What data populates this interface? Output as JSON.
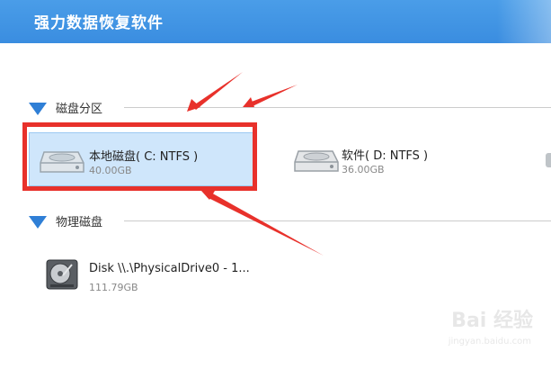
{
  "app": {
    "title": "强力数据恢复软件"
  },
  "sections": {
    "partitions": {
      "label": "磁盘分区"
    },
    "physical": {
      "label": "物理磁盘"
    }
  },
  "drives": [
    {
      "name": "本地磁盘( C: NTFS )",
      "size": "40.00GB",
      "icon": "drive-icon",
      "selected": true
    },
    {
      "name": "软件( D: NTFS )",
      "size": "36.00GB",
      "icon": "drive-icon",
      "selected": false
    }
  ],
  "physical_disks": [
    {
      "name": "Disk \\\\.\\PhysicalDrive0 - 1...",
      "size": "111.79GB",
      "icon": "hard-disk-icon"
    }
  ],
  "annotation": {
    "color": "#e8312b"
  },
  "colors": {
    "titlebar": "#3a8de0",
    "accent": "#2f7fd6",
    "selected_bg": "#cfe6fb"
  },
  "watermark": {
    "text": "Bai 经验",
    "url": "jingyan.baidu.com"
  }
}
